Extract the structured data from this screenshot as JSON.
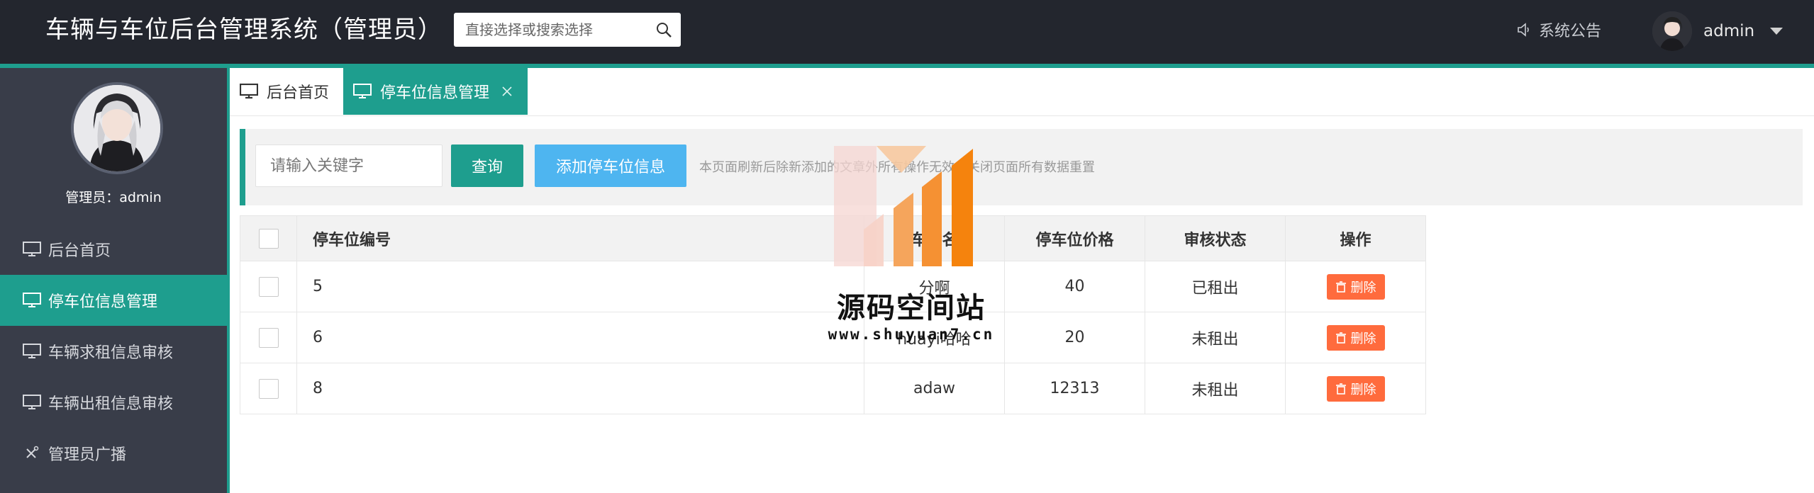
{
  "header": {
    "title": "车辆与车位后台管理系统（管理员）",
    "search_placeholder": "直接选择或搜索选择",
    "notice_label": "系统公告",
    "username": "admin"
  },
  "sidebar": {
    "profile_label": "管理员：admin",
    "items": [
      {
        "label": "后台首页",
        "icon": "monitor-icon",
        "active": false
      },
      {
        "label": "停车位信息管理",
        "icon": "monitor-icon",
        "active": true
      },
      {
        "label": "车辆求租信息审核",
        "icon": "monitor-icon",
        "active": false
      },
      {
        "label": "车辆出租信息审核",
        "icon": "monitor-icon",
        "active": false
      },
      {
        "label": "管理员广播",
        "icon": "tools-icon",
        "active": false
      }
    ]
  },
  "tabs": [
    {
      "label": "后台首页",
      "active": false
    },
    {
      "label": "停车位信息管理",
      "active": true,
      "closable": true
    }
  ],
  "toolbar": {
    "keyword_placeholder": "请输入关键字",
    "query_label": "查询",
    "add_label": "添加停车位信息",
    "tip": "本页面刷新后除新添加的文章外所有操作无效，关闭页面所有数据重置"
  },
  "table": {
    "headers": [
      "停车位编号",
      "车位名",
      "停车位价格",
      "审核状态",
      "操作"
    ],
    "rows": [
      {
        "no": "5",
        "name": "分啊",
        "price": "40",
        "status": "已租出",
        "action": "删除"
      },
      {
        "no": "6",
        "name": "huayi哈哈",
        "price": "20",
        "status": "未租出",
        "action": "删除"
      },
      {
        "no": "8",
        "name": "adaw",
        "price": "12313",
        "status": "未租出",
        "action": "删除"
      }
    ]
  },
  "watermark": {
    "text": "源码空间站",
    "url": "www.shuyuan7.cn"
  },
  "colors": {
    "header_bg": "#23262e",
    "sidebar_bg": "#393d49",
    "accent_teal": "#1e9e8e",
    "add_button_blue": "#4eb5f0",
    "delete_orange": "#ff6b3d"
  }
}
